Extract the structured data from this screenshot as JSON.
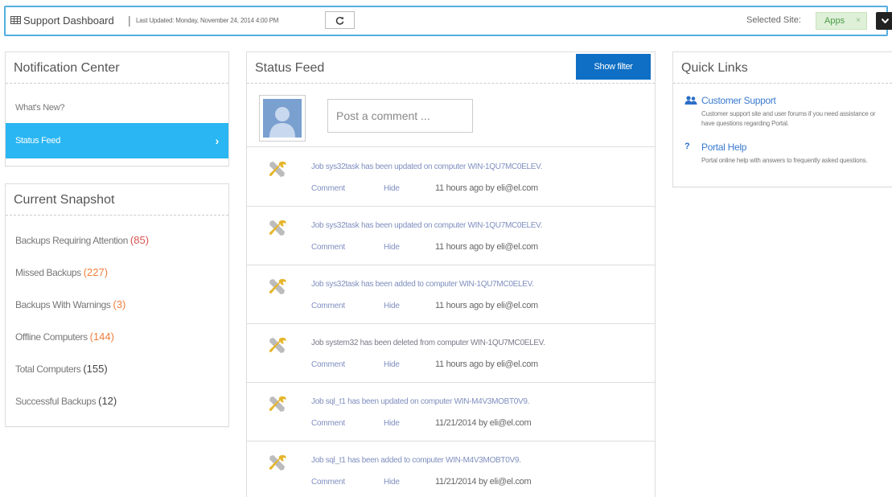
{
  "topbar": {
    "title": "Support Dashboard",
    "separator": "|",
    "last_updated": "Last Updated: Monday, November 24, 2014 4:00 PM",
    "refresh_icon": "refresh-icon",
    "selected_site_label": "Selected Site:",
    "selected_site_value": "Apps",
    "chip_remove": "×",
    "dropdown_icon": "chevron-down-icon"
  },
  "notification_center": {
    "title": "Notification Center",
    "items": [
      {
        "label": "What's New?"
      },
      {
        "label": "Status Feed",
        "active": true
      }
    ]
  },
  "snapshot": {
    "title": "Current Snapshot",
    "rows": [
      {
        "label": "Backups Requiring Attention",
        "count": "(85)"
      },
      {
        "label": "Missed Backups",
        "count": "(227)"
      },
      {
        "label": "Backups With Warnings",
        "count": "(3)"
      },
      {
        "label": "Offline Computers",
        "count": "(144)"
      },
      {
        "label": "Total Computers",
        "count": "(155)"
      },
      {
        "label": "Successful Backups",
        "count": "(12)"
      }
    ]
  },
  "feed": {
    "title": "Status Feed",
    "show_filter": "Show filter",
    "comment_placeholder": "Post a comment ...",
    "comment_label": "Comment",
    "hide_label": "Hide",
    "items": [
      {
        "text": "Job sys32task has been updated on computer WIN-1QU7MC0ELEV.",
        "time": "11 hours ago by eli@el.com"
      },
      {
        "text": "Job sys32task has been updated on computer WIN-1QU7MC0ELEV.",
        "time": "11 hours ago by eli@el.com"
      },
      {
        "text": "Job sys32task has been added to computer WIN-1QU7MC0ELEV.",
        "time": "11 hours ago by eli@el.com"
      },
      {
        "text": "Job system32 has been deleted from computer WIN-1QU7MC0ELEV.",
        "time": "11 hours ago by eli@el.com"
      },
      {
        "text": "Job sql_t1 has been updated on computer WIN-M4V3MOBT0V9.",
        "time": "11/21/2014 by eli@el.com"
      },
      {
        "text": "Job sql_t1 has been added to computer WIN-M4V3MOBT0V9.",
        "time": "11/21/2014 by eli@el.com"
      }
    ]
  },
  "quick_links": {
    "title": "Quick Links",
    "links": [
      {
        "icon": "users-icon",
        "title": "Customer Support",
        "desc": "Customer support site and user forums if you need assistance or have questions regarding Portal."
      },
      {
        "icon": "question-icon",
        "title": "Portal Help",
        "desc": "Portal online help with answers to frequently asked questions."
      }
    ]
  },
  "colors": {
    "accent": "#29b6f2",
    "button_blue": "#0e6fc4",
    "top_border": "#55aee0",
    "red_count": "#d9534f",
    "orange_count": "#ef7e3b",
    "link": "#3a7ad0"
  }
}
